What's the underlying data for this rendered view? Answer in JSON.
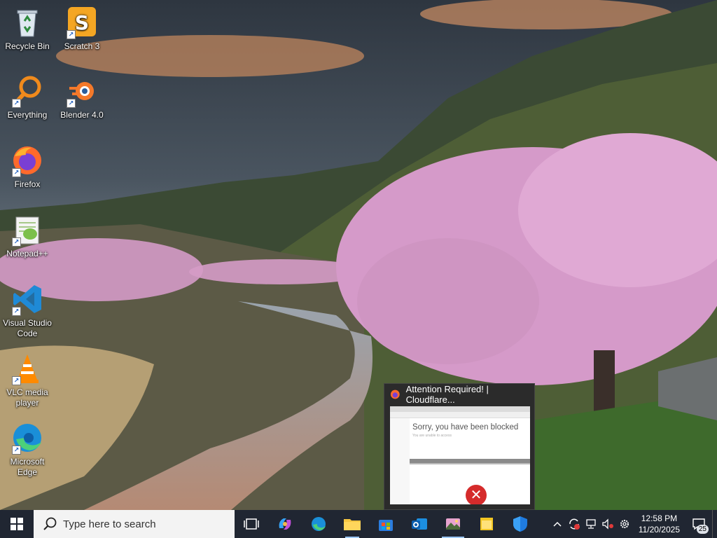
{
  "desktop": {
    "icons": [
      {
        "label": "Recycle Bin",
        "icon": "recycle-bin-icon"
      },
      {
        "label": "Scratch 3",
        "icon": "scratch-icon"
      },
      {
        "label": "Everything",
        "icon": "everything-search-icon"
      },
      {
        "label": "Blender 4.0",
        "icon": "blender-icon"
      },
      {
        "label": "Firefox",
        "icon": "firefox-icon"
      },
      {
        "label": "Notepad++",
        "icon": "notepadpp-icon"
      },
      {
        "label": "Visual Studio Code",
        "icon": "vscode-icon"
      },
      {
        "label": "VLC media player",
        "icon": "vlc-icon"
      },
      {
        "label": "Microsoft Edge",
        "icon": "edge-icon"
      }
    ]
  },
  "preview": {
    "title": "Attention Required! | Cloudflare...",
    "page_heading": "Sorry, you have been blocked",
    "page_subtext": "You are unable to access"
  },
  "taskbar": {
    "search_placeholder": "Type here to search",
    "time": "12:58 PM",
    "date": "11/20/2025",
    "notification_count": "25",
    "accent": "#9ec9ff"
  }
}
